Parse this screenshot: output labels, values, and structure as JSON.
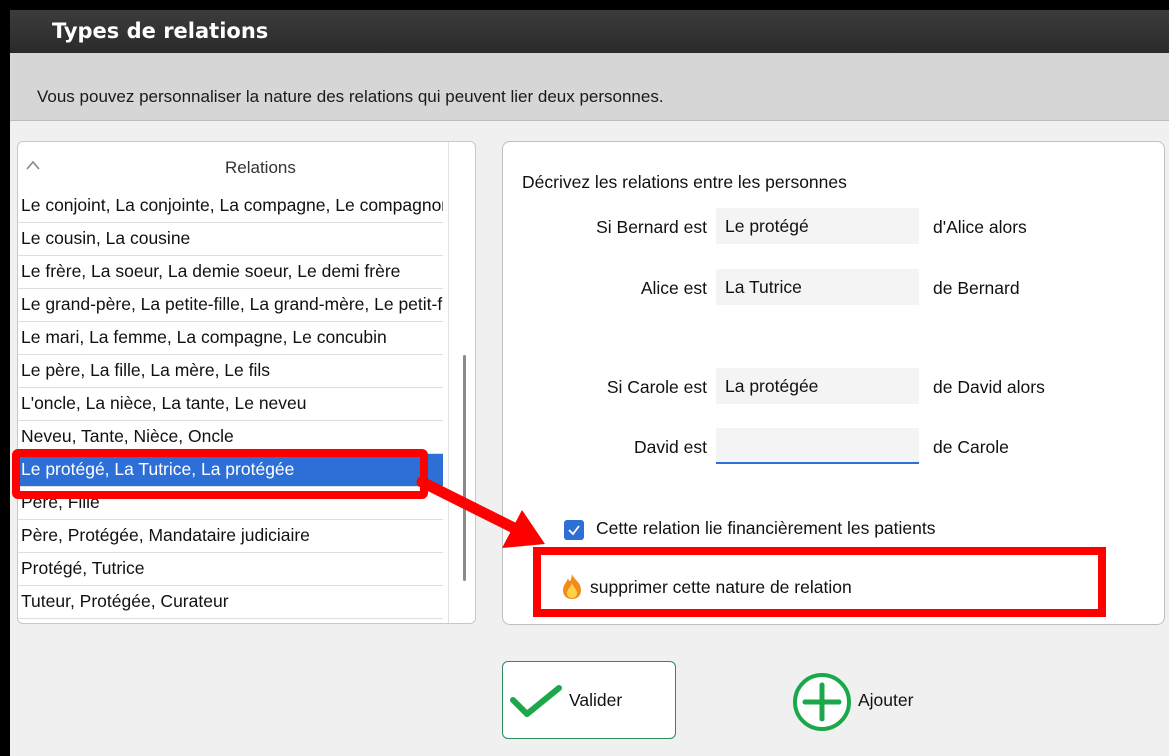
{
  "window": {
    "title": "Types de relations"
  },
  "banner": {
    "text": "Vous pouvez personnaliser la nature des relations qui peuvent lier deux personnes."
  },
  "list": {
    "header": "Relations",
    "items": [
      "Le conjoint, La conjointe, La compagne, Le compagnon",
      "Le cousin, La cousine",
      "Le frère, La soeur, La demie soeur, Le demi frère",
      "Le grand-père, La petite-fille, La grand-mère, Le petit-fils",
      "Le mari, La femme, La compagne, Le concubin",
      "Le père, La fille, La mère, Le fils",
      "L'oncle, La nièce, La tante, Le neveu",
      "Neveu, Tante, Nièce, Oncle",
      "Le protégé, La Tutrice, La protégée",
      "Père, Fille",
      "Père, Protégée, Mandataire judiciaire",
      "Protégé, Tutrice",
      "Tuteur, Protégée, Curateur"
    ],
    "selected_index": 8
  },
  "form": {
    "title": "Décrivez les relations entre les personnes",
    "row1": {
      "label": "Si Bernard est",
      "value": "Le protégé",
      "suffix": "d'Alice alors"
    },
    "row2": {
      "label": "Alice est",
      "value": "La Tutrice",
      "suffix": "de Bernard"
    },
    "row3": {
      "label": "Si Carole est",
      "value": "La protégée",
      "suffix": "de David alors"
    },
    "row4": {
      "label": "David est",
      "value": "",
      "suffix": "de Carole"
    },
    "checkbox": {
      "label": "Cette relation lie financièrement les patients",
      "checked": true
    },
    "delete_label": "supprimer cette nature de relation"
  },
  "buttons": {
    "valider": "Valider",
    "ajouter": "Ajouter"
  },
  "colors": {
    "accent": "#2d6fd6",
    "annotation": "#ff0000",
    "valider_check": "#1aa84a",
    "ajouter_plus": "#1aa84a"
  },
  "icons": {
    "delete": "flame-icon",
    "valider": "checkmark-icon",
    "ajouter": "plus-circle-icon"
  }
}
